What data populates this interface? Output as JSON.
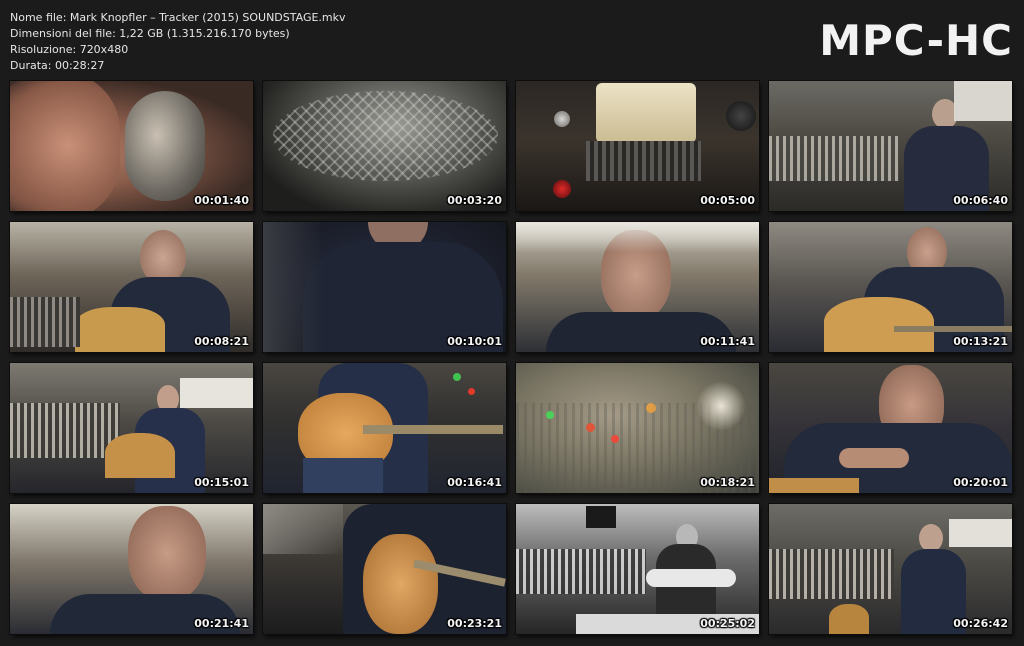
{
  "info": {
    "filename_line": "Nome file: Mark Knopfler – Tracker (2015) SOUNDSTAGE.mkv",
    "size_line": "Dimensioni del file: 1,22 GB (1.315.216.170 bytes)",
    "resolution_line": "Risoluzione: 720x480",
    "duration_line": "Durata: 00:28:27"
  },
  "brand": "MPC-HC",
  "thumbnails": [
    {
      "timestamp": "00:01:40"
    },
    {
      "timestamp": "00:03:20"
    },
    {
      "timestamp": "00:05:00"
    },
    {
      "timestamp": "00:06:40"
    },
    {
      "timestamp": "00:08:21"
    },
    {
      "timestamp": "00:10:01"
    },
    {
      "timestamp": "00:11:41"
    },
    {
      "timestamp": "00:13:21"
    },
    {
      "timestamp": "00:15:01"
    },
    {
      "timestamp": "00:16:41"
    },
    {
      "timestamp": "00:18:21"
    },
    {
      "timestamp": "00:20:01"
    },
    {
      "timestamp": "00:21:41"
    },
    {
      "timestamp": "00:23:21"
    },
    {
      "timestamp": "00:25:02"
    },
    {
      "timestamp": "00:26:42"
    }
  ]
}
